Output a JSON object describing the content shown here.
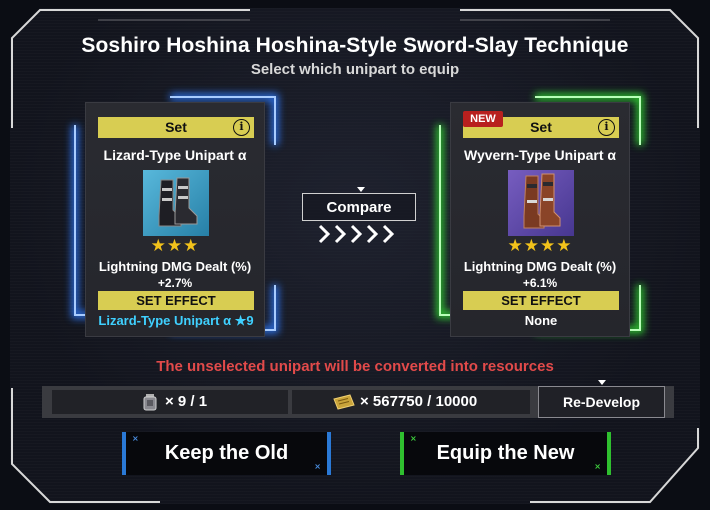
{
  "dialog": {
    "title": "Soshiro Hoshina Hoshina-Style Sword-Slay Technique",
    "subtitle": "Select which unipart to equip"
  },
  "cards": {
    "old": {
      "set_label": "Set",
      "name": "Lizard-Type Unipart α",
      "stars": "★★★",
      "star_count": 3,
      "stat_name": "Lightning DMG Dealt (%)",
      "stat_value": "+2.7%",
      "set_effect_label": "SET EFFECT",
      "set_effect_value": "Lizard-Type Unipart α ★9",
      "glow_color": "#2f7cff",
      "effect_color": "#3fd0ff",
      "image_bg": "#3aa0c8"
    },
    "new": {
      "badge": "NEW",
      "set_label": "Set",
      "name": "Wyvern-Type Unipart α",
      "stars": "★★★★",
      "star_count": 4,
      "stat_name": "Lightning DMG Dealt (%)",
      "stat_value": "+6.1%",
      "set_effect_label": "SET EFFECT",
      "set_effect_value": "None",
      "glow_color": "#30e030",
      "effect_color": "#ffffff",
      "image_bg": "#5a4aa8"
    }
  },
  "compare": {
    "label": "Compare"
  },
  "warning": "The unselected unipart will be converted into resources",
  "resources": {
    "material_icon": "canister-icon",
    "material_text": "× 9 / 1",
    "ticket_icon": "ticket-icon",
    "ticket_text": "× 567750 / 10000",
    "redevelop_label": "Re-Develop"
  },
  "actions": {
    "keep_label": "Keep the Old",
    "equip_label": "Equip the New",
    "keep_color": "#2a79d6",
    "equip_color": "#2fbf2f"
  },
  "colors": {
    "accent_yellow": "#d8cd52",
    "warning_red": "#e24a4a",
    "star_gold": "#f2c21b"
  }
}
